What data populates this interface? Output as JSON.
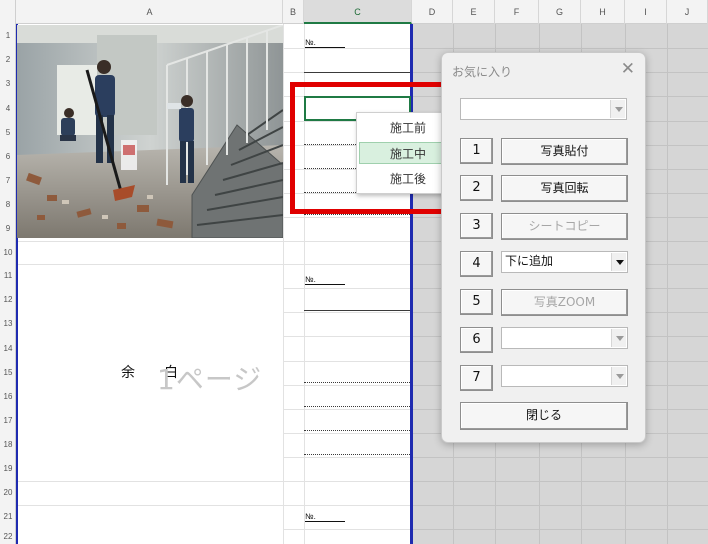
{
  "sheet": {
    "columns": [
      "A",
      "B",
      "C",
      "D",
      "E",
      "F",
      "G",
      "H",
      "I",
      "J"
    ],
    "rows": [
      "1",
      "2",
      "3",
      "4",
      "5",
      "6",
      "7",
      "8",
      "9",
      "10",
      "11",
      "12",
      "13",
      "14",
      "15",
      "16",
      "17",
      "18",
      "19",
      "20",
      "21",
      "22"
    ],
    "no_label": "№.",
    "margin_char_1": "余",
    "margin_char_2": "白",
    "page_watermark": "1ページ"
  },
  "context_menu": {
    "items": [
      "施工前",
      "施工中",
      "施工後"
    ],
    "active_index": 1
  },
  "dialog": {
    "title": "お気に入り",
    "close_glyph": "✕",
    "top_combo_value": "",
    "number_buttons": [
      "1",
      "2",
      "3",
      "4",
      "5",
      "6",
      "7"
    ],
    "actions": {
      "paste_photo": "写真貼付",
      "rotate_photo": "写真回転",
      "copy_sheet": "シートコピー",
      "add_below_combo": "下に追加",
      "photo_zoom": "写真ZOOM",
      "combo6": "",
      "combo7": "",
      "close": "閉じる"
    },
    "disabled": [
      "copy_sheet",
      "photo_zoom"
    ]
  },
  "colors": {
    "highlight": "#e00000",
    "selection": "#1f7a44",
    "page_border": "#1f2bb0",
    "menu_active": "#d9f0df"
  },
  "icons": [
    "close-icon",
    "dropdown-arrow-icon"
  ]
}
